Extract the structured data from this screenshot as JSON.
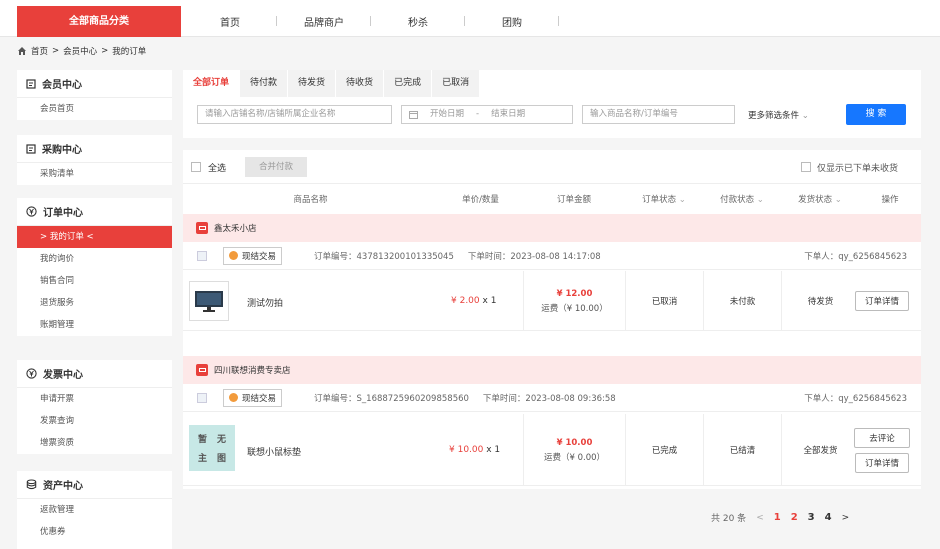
{
  "topnav": {
    "category_btn": "全部商品分类",
    "items": [
      "首页",
      "品牌商户",
      "秒杀",
      "团购"
    ]
  },
  "breadcrumb": {
    "home": "首页",
    "level1": "会员中心",
    "level2": "我的订单",
    "sep": ">"
  },
  "sidebar": [
    {
      "title": "会员中心",
      "icon": "member-icon",
      "items": [
        "会员首页"
      ]
    },
    {
      "title": "采购中心",
      "icon": "purchase-icon",
      "items": [
        "采购清单"
      ]
    },
    {
      "title": "订单中心",
      "icon": "yen-circle-icon",
      "items": [
        "> 我的订单 <",
        "我的询价",
        "销售合同",
        "退货服务",
        "账期管理"
      ],
      "active": 0
    },
    {
      "title": "发票中心",
      "icon": "yen-circle-icon",
      "items": [
        "申请开票",
        "发票查询",
        "增票资质"
      ]
    },
    {
      "title": "资产中心",
      "icon": "database-icon",
      "items": [
        "返款管理",
        "优惠券"
      ]
    }
  ],
  "tabs": [
    "全部订单",
    "待付款",
    "待发货",
    "待收货",
    "已完成",
    "已取消"
  ],
  "filters": {
    "store_placeholder": "请输入店铺名称/店铺所属企业名称",
    "start_date": "开始日期",
    "date_sep": "-",
    "end_date": "结束日期",
    "product_placeholder": "输入商品名称/订单编号",
    "more": "更多筛选条件",
    "search": "搜 索"
  },
  "select_bar": {
    "select_all": "全选",
    "merge_pay": "合并付款",
    "only_unreceived": "仅显示已下单未收货"
  },
  "columns": [
    "商品名称",
    "单价/数量",
    "订单金额",
    "订单状态",
    "付款状态",
    "发货状态",
    "操作"
  ],
  "orders": [
    {
      "store": "鑫太禾小店",
      "trade_tag": "现结交易",
      "order_no": "订单编号：437813200101335045",
      "order_time": "下单时间：2023-08-08 14:17:08",
      "buyer": "下单人：qy_6256845623",
      "product": "测试勿拍",
      "price": "¥ 2.00",
      "qty": "x 1",
      "amount": "¥ 12.00",
      "freight": "运费（¥ 10.00）",
      "order_status": "已取消",
      "pay_status": "未付款",
      "ship_status": "待发货",
      "actions": [
        "订单详情"
      ]
    },
    {
      "store": "四川联想消费专卖店",
      "trade_tag": "现结交易",
      "order_no": "订单编号：S_1688725960209858560",
      "order_time": "下单时间：2023-08-08 09:36:58",
      "buyer": "下单人：qy_6256845623",
      "product": "联想小鼠标垫",
      "image_text": [
        "暂",
        "无",
        "主",
        "图"
      ],
      "price": "¥ 10.00",
      "qty": "x 1",
      "amount": "¥ 10.00",
      "freight": "运费（¥ 0.00）",
      "order_status": "已完成",
      "pay_status": "已结清",
      "ship_status": "全部发货",
      "actions": [
        "去评论",
        "订单详情"
      ]
    }
  ],
  "pager": {
    "total": "共 20 条",
    "prev": "<",
    "pages": [
      "1",
      "2",
      "3",
      "4"
    ],
    "next": ">"
  }
}
